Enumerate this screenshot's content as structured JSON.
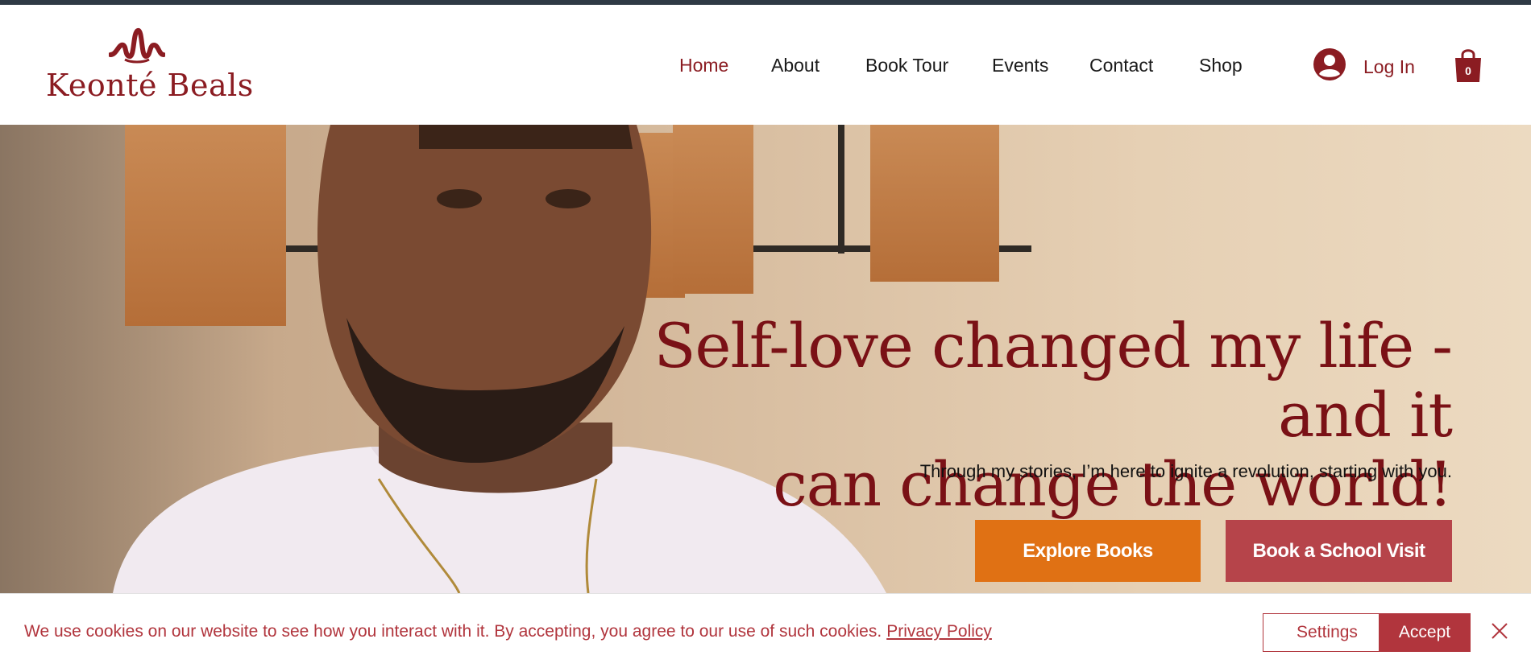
{
  "brand": {
    "name": "Keonté Beals"
  },
  "nav": {
    "items": [
      {
        "label": "Home",
        "active": true
      },
      {
        "label": "About"
      },
      {
        "label": "Book Tour"
      },
      {
        "label": "Events"
      },
      {
        "label": "Contact"
      },
      {
        "label": "Shop"
      }
    ]
  },
  "account": {
    "login_label": "Log In",
    "avatar_icon": "user-avatar-icon"
  },
  "cart": {
    "count": "0",
    "icon": "shopping-bag-icon"
  },
  "hero": {
    "headline_line1": "Self-love changed my life - and it",
    "headline_line2": "can change the world!",
    "subline": "Through my stories, I’m here to ignite a revolution, starting with you.",
    "primary_button": "Explore Books",
    "secondary_button": "Book a School Visit"
  },
  "cookie_banner": {
    "message": "We use cookies on our website to see how you interact with it. By accepting, you agree to our use of such cookies.",
    "link": "Privacy Policy",
    "settings_label": "Settings",
    "accept_label": "Accept",
    "close_icon": "close-icon"
  },
  "colors": {
    "brand": "#8b1c22",
    "primary_button": "#e07114",
    "secondary_button": "#b6444a",
    "cookie_accent": "#b1353d"
  }
}
